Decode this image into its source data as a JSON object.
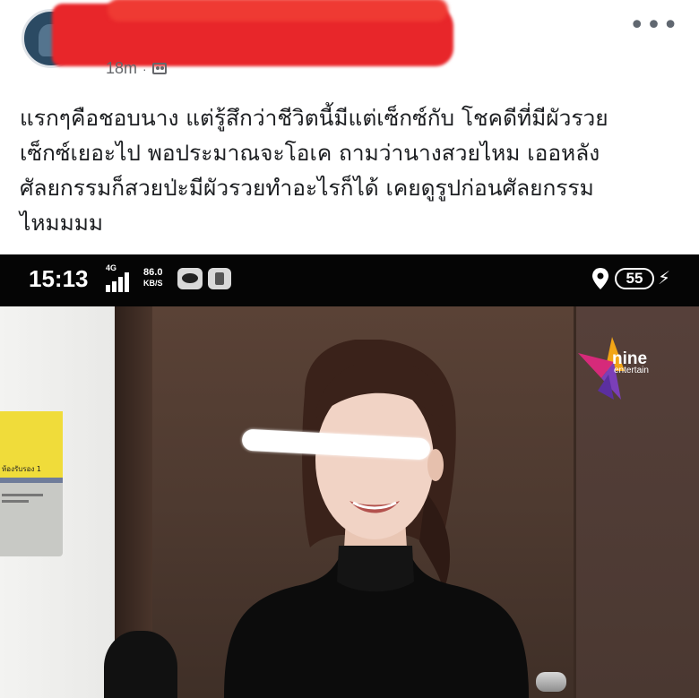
{
  "post": {
    "time": "18m",
    "dot": "·",
    "audience_icon": "friends-icon",
    "more_label": "•••",
    "text": "แรกๆคือชอบนาง แต่รู้สึกว่าชีวิตนี้มีแต่เซ็กซ์กับ โชคดีที่มีผัวรวย\nเซ็กซ์เยอะไป พอประมาณจะโอเค ถามว่านางสวยไหม เออหลัง\nศัลยกรรมก็สวยป่ะมีผัวรวยทำอะไรก็ได้ เคยดูรูปก่อนศัลยกรรม\nไหมมมม"
  },
  "photo": {
    "status_bar": {
      "time": "15:13",
      "network": "4G",
      "speed_value": "86.0",
      "speed_unit": "KB/S",
      "battery": "55",
      "charging_icon": "⚡"
    },
    "logo": {
      "name": "nine",
      "sub": "entertain"
    },
    "sign_text": "ห้องรับรอง 1"
  },
  "colors": {
    "redaction": "#e8262a",
    "text": "#1c1e21",
    "meta": "#65676b"
  }
}
